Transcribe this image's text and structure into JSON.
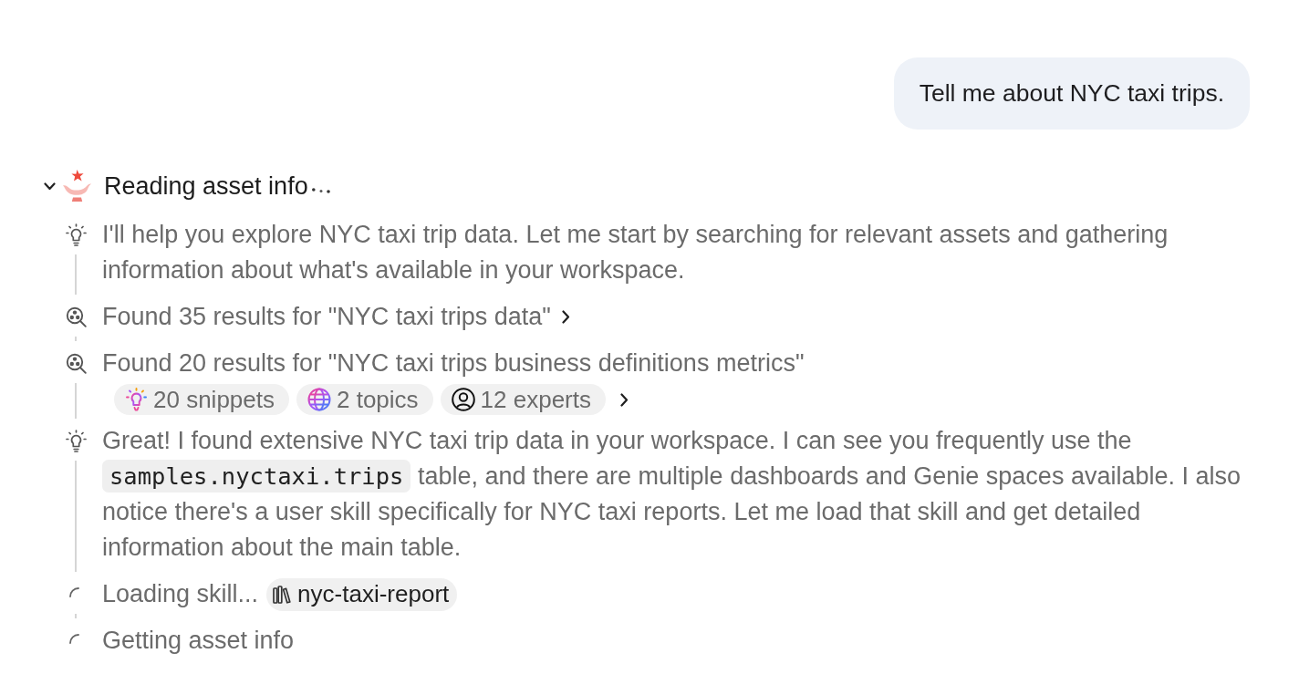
{
  "user_message": {
    "text": "Tell me about NYC taxi trips."
  },
  "activity": {
    "title": "Reading asset info",
    "expanded": true,
    "in_progress": true,
    "steps": [
      {
        "kind": "thought",
        "text": "I'll help you explore NYC taxi trip data. Let me start by searching for relevant assets and gathering information about what's available in your workspace.",
        "expandable": false
      },
      {
        "kind": "search",
        "text": "Found 35 results for \"NYC taxi trips data\"",
        "expandable": true
      },
      {
        "kind": "search",
        "text": "Found 20 results for \"NYC taxi trips business definitions metrics\"",
        "expandable": true,
        "chips": [
          {
            "kind": "snippets",
            "label": "20 snippets"
          },
          {
            "kind": "topics",
            "label": "2 topics"
          },
          {
            "kind": "experts",
            "label": "12 experts"
          }
        ]
      },
      {
        "kind": "thought",
        "expandable": false,
        "parts": [
          {
            "kind": "text",
            "text": "Great! I found extensive NYC taxi trip data in your workspace. I can see you frequently use the"
          },
          {
            "kind": "code",
            "text": "samples.nyctaxi.trips"
          },
          {
            "kind": "text",
            "text": "table, and there are multiple dashboards and Genie spaces available. I also notice there's a user skill specifically for NYC taxi reports. Let me load that skill and get detailed information about the main table."
          }
        ]
      },
      {
        "kind": "pending",
        "text": "Loading skill...",
        "expandable": false,
        "skill": {
          "label": "nyc-taxi-report"
        }
      },
      {
        "kind": "pending",
        "text": "Getting asset info",
        "expandable": false
      }
    ]
  }
}
